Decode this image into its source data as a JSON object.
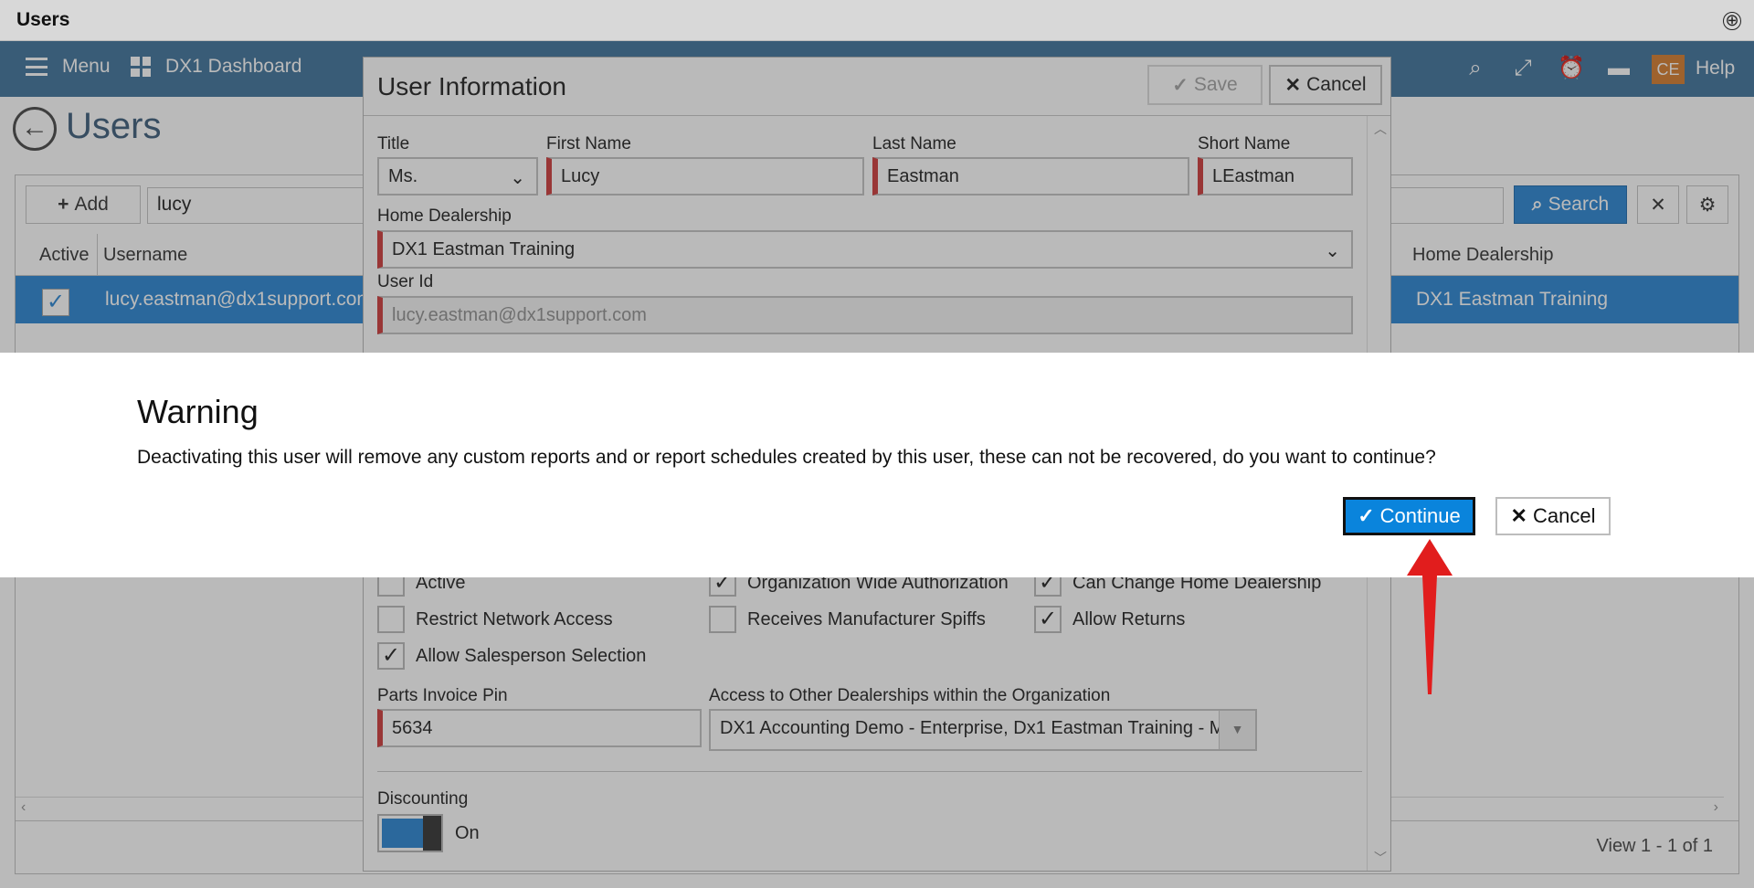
{
  "window": {
    "title": "Users",
    "plus_icon": "⊕"
  },
  "nav": {
    "menu_label": "Menu",
    "dashboard_label": "DX1 Dashboard",
    "avatar_initials": "CE",
    "help_label": "Help"
  },
  "page": {
    "title": "Users"
  },
  "grid": {
    "add_label": "Add",
    "search_value": "lucy",
    "search_label": "Search",
    "columns": [
      "Active",
      "Username",
      "Home Dealership"
    ],
    "row": {
      "username": "lucy.eastman@dx1support.com",
      "dealership": "DX1 Eastman Training"
    },
    "pager_text": "View 1 - 1 of 1"
  },
  "modal": {
    "title": "User Information",
    "save_label": "Save",
    "cancel_label": "Cancel",
    "labels": {
      "title": "Title",
      "first_name": "First Name",
      "last_name": "Last Name",
      "short_name": "Short Name",
      "home_dealership": "Home Dealership",
      "user_id": "User Id",
      "parts_pin": "Parts Invoice Pin",
      "access": "Access to Other Dealerships within the Organization",
      "discounting": "Discounting"
    },
    "values": {
      "title": "Ms.",
      "first_name": "Lucy",
      "last_name": "Eastman",
      "short_name": "LEastman",
      "home_dealership": "DX1 Eastman Training",
      "user_id": "lucy.eastman@dx1support.com",
      "parts_pin": "5634",
      "access": "DX1 Accounting Demo - Enterprise, Dx1 Eastman Training - M...",
      "discounting_state": "On"
    },
    "checkboxes": [
      {
        "label": "Active",
        "checked": false
      },
      {
        "label": "Organization Wide Authorization",
        "checked": true
      },
      {
        "label": "Can Change Home Dealership",
        "checked": true
      },
      {
        "label": "Restrict Network Access",
        "checked": false
      },
      {
        "label": "Receives Manufacturer Spiffs",
        "checked": false
      },
      {
        "label": "Allow Returns",
        "checked": true
      },
      {
        "label": "Allow Salesperson Selection",
        "checked": true
      }
    ]
  },
  "warning": {
    "title": "Warning",
    "message": "Deactivating this user will remove any custom reports and or report schedules created by this user, these can not be recovered, do you want to continue?",
    "continue_label": "Continue",
    "cancel_label": "Cancel"
  },
  "colors": {
    "nav_bg": "#4f7ea3",
    "accent": "#3b8fd6",
    "continue_bg": "#0a84dc",
    "required": "#d24a4a",
    "annotation_arrow": "#e11d1d"
  }
}
